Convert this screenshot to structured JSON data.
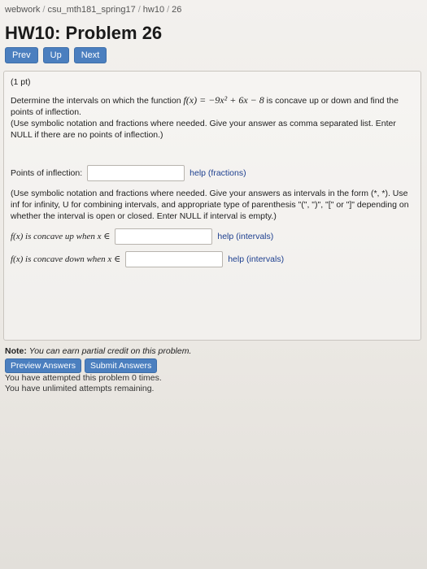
{
  "breadcrumb": {
    "items": [
      "webwork",
      "csu_mth181_spring17",
      "hw10",
      "26"
    ],
    "separator": "/"
  },
  "page_title": "HW10: Problem 26",
  "nav": {
    "prev": "Prev",
    "up": "Up",
    "next": "Next"
  },
  "problem": {
    "points": "(1 pt)",
    "intro_before": "Determine the intervals on which the function ",
    "function_math": "f(x) = −9x² + 6x − 8",
    "intro_after": " is concave up or down and find the points of inflection.",
    "intro_note": "(Use symbolic notation and fractions where needed. Give your answer as comma separated list. Enter NULL if there are no points of inflection.)",
    "inflection_label": "Points of inflection:",
    "inflection_value": "",
    "inflection_help": "help (fractions)",
    "interval_note": "(Use symbolic notation and fractions where needed. Give your answers as intervals in the form (*, *). Use inf for infinity, U for combining intervals, and appropriate type of parenthesis \"(\", \")\", \"[\" or \"]\" depending on whether the interval is open or closed. Enter NULL if interval is empty.)",
    "concave_up_label": "f(x) is concave up when x ∈",
    "concave_up_value": "",
    "concave_up_help": "help (intervals)",
    "concave_down_label": "f(x) is concave down when x ∈",
    "concave_down_value": "",
    "concave_down_help": "help (intervals)"
  },
  "note": {
    "label": "Note:",
    "text": "You can earn partial credit on this problem."
  },
  "actions": {
    "preview": "Preview Answers",
    "submit": "Submit Answers"
  },
  "status": {
    "attempts": "You have attempted this problem 0 times.",
    "remaining": "You have unlimited attempts remaining."
  },
  "colors": {
    "button": "#4b7fbf",
    "link": "#1d3f8f"
  }
}
